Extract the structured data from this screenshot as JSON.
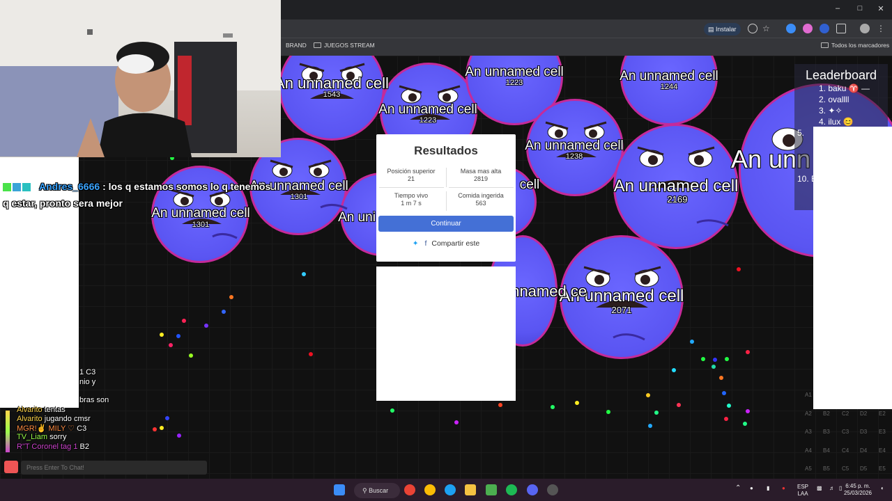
{
  "browser": {
    "install_label": "Instalar",
    "bookmarks": [
      "BRAND",
      "JUEGOS STREAM"
    ],
    "all_bookmarks": "Todos los marcadores"
  },
  "cells": [
    {
      "name": "An unnamed cell",
      "mass": "1543"
    },
    {
      "name": "An unnamed cell",
      "mass": "1223"
    },
    {
      "name": "An unnamed cell",
      "mass": "1223"
    },
    {
      "name": "An unnamed cell",
      "mass": "1244"
    },
    {
      "name": "An unnamed cell",
      "mass": "1238"
    },
    {
      "name": "An unnamed cell",
      "mass": "1301"
    },
    {
      "name": "An unnamed cell",
      "mass": "1301"
    },
    {
      "name": "An unnamed cell",
      "mass": "2169"
    },
    {
      "name": "An unnamed cell",
      "mass": "2071"
    },
    {
      "name": "An unn",
      "mass": ""
    },
    {
      "name": "An uni",
      "mass": ""
    },
    {
      "name": "cell",
      "mass": ""
    },
    {
      "name": "An unnamed ce",
      "mass": ""
    }
  ],
  "leaderboard": {
    "title": "Leaderboard",
    "items": [
      "1. baku ♈ —",
      "2. ovallll",
      "3. ✦✧",
      "4. ilux 😊",
      "5.",
      "10. E"
    ]
  },
  "results": {
    "title": "Resultados",
    "stats": [
      {
        "label": "Posición superior",
        "value": "21"
      },
      {
        "label": "Masa mas alta",
        "value": "2819"
      },
      {
        "label": "Tiempo vivo",
        "value": "1 m 7 s"
      },
      {
        "label": "Comida ingerida",
        "value": "563"
      }
    ],
    "continue_label": "Continuar",
    "share_label": "Compartir este"
  },
  "chat": {
    "main_user": "Andres_6666",
    "main_message": ": los q estamos somos lo q tenemos",
    "main_message_cont": "q estar, pronto sera mejor",
    "small_lines": [
      {
        "user": "",
        "text": "1 C3",
        "color": "#ff66cc"
      },
      {
        "user": "",
        "text": "nio y",
        "color": "#ffffff"
      },
      {
        "user": "",
        "text": "bras son",
        "color": "#ffffff"
      },
      {
        "user": "Alvarito",
        "text": "tentas",
        "color": "#ffd54a"
      },
      {
        "user": "Alvarito",
        "text": "jugando cmsr",
        "color": "#ffd54a"
      },
      {
        "user": "MGR!✌️ MILY ♡",
        "text": "C3",
        "color": "#ff8c42"
      },
      {
        "user": "TV_Liam",
        "text": "sorry",
        "color": "#9bff4a"
      },
      {
        "user": "R\"T Coronel tag 1",
        "text": "B2",
        "color": "#cc44cc"
      }
    ],
    "input_placeholder": "Press Enter To Chat!"
  },
  "grid_labels": [
    "A1",
    "A2",
    "B2",
    "C2",
    "D2",
    "E2",
    "A3",
    "B3",
    "C3",
    "D3",
    "E3",
    "A4",
    "B4",
    "C4",
    "D4",
    "E4",
    "A5",
    "B5",
    "C5",
    "D5",
    "E5"
  ],
  "taskbar": {
    "search_label": "Buscar",
    "lang": "ESP",
    "lang2": "LAA",
    "time": "6:45 p. m.",
    "date": "25/03/2026"
  },
  "colors": {
    "cell_fill": "#5a55f2",
    "cell_border": "#c52a9a",
    "button": "#4470d6"
  }
}
